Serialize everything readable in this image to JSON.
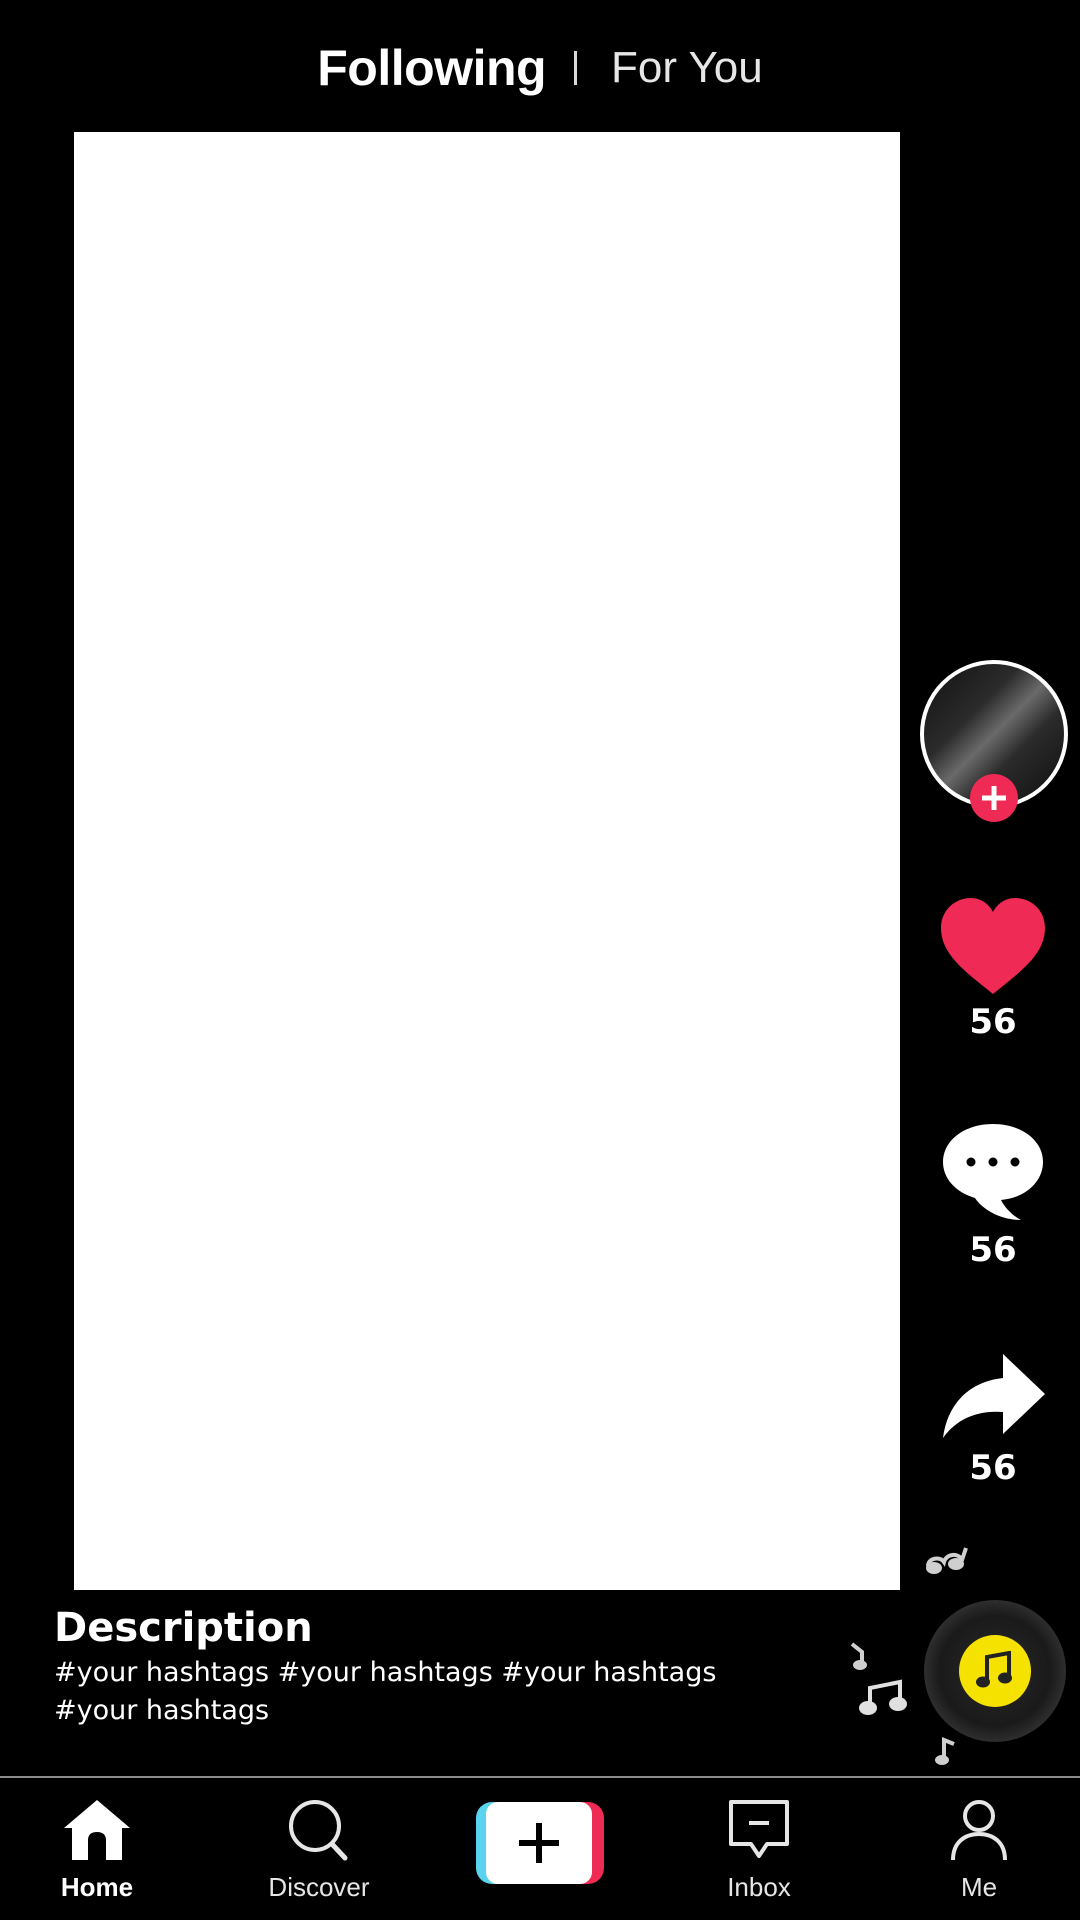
{
  "header": {
    "tab_following": "Following",
    "tab_for_you": "For You"
  },
  "actions": {
    "likes": "56",
    "comments": "56",
    "shares": "56"
  },
  "description": {
    "title": "Description",
    "hashtags_line1": "#your hashtags #your hashtags #your hashtags",
    "hashtags_line2": "#your hashtags"
  },
  "nav": {
    "home": "Home",
    "discover": "Discover",
    "inbox": "Inbox",
    "me": "Me"
  },
  "icons": {
    "avatar": "avatar",
    "follow": "plus-icon",
    "like": "heart-icon",
    "comment": "comment-icon",
    "share": "share-icon",
    "music": "music-note-icon",
    "home": "home-icon",
    "discover": "search-icon",
    "create": "plus-icon",
    "inbox": "inbox-icon",
    "me": "profile-icon"
  },
  "colors": {
    "background": "#000000",
    "accent_red": "#ee2a55",
    "accent_cyan": "#5ad3ee",
    "music_yellow": "#f6e200",
    "video_placeholder": "#ffffff"
  }
}
